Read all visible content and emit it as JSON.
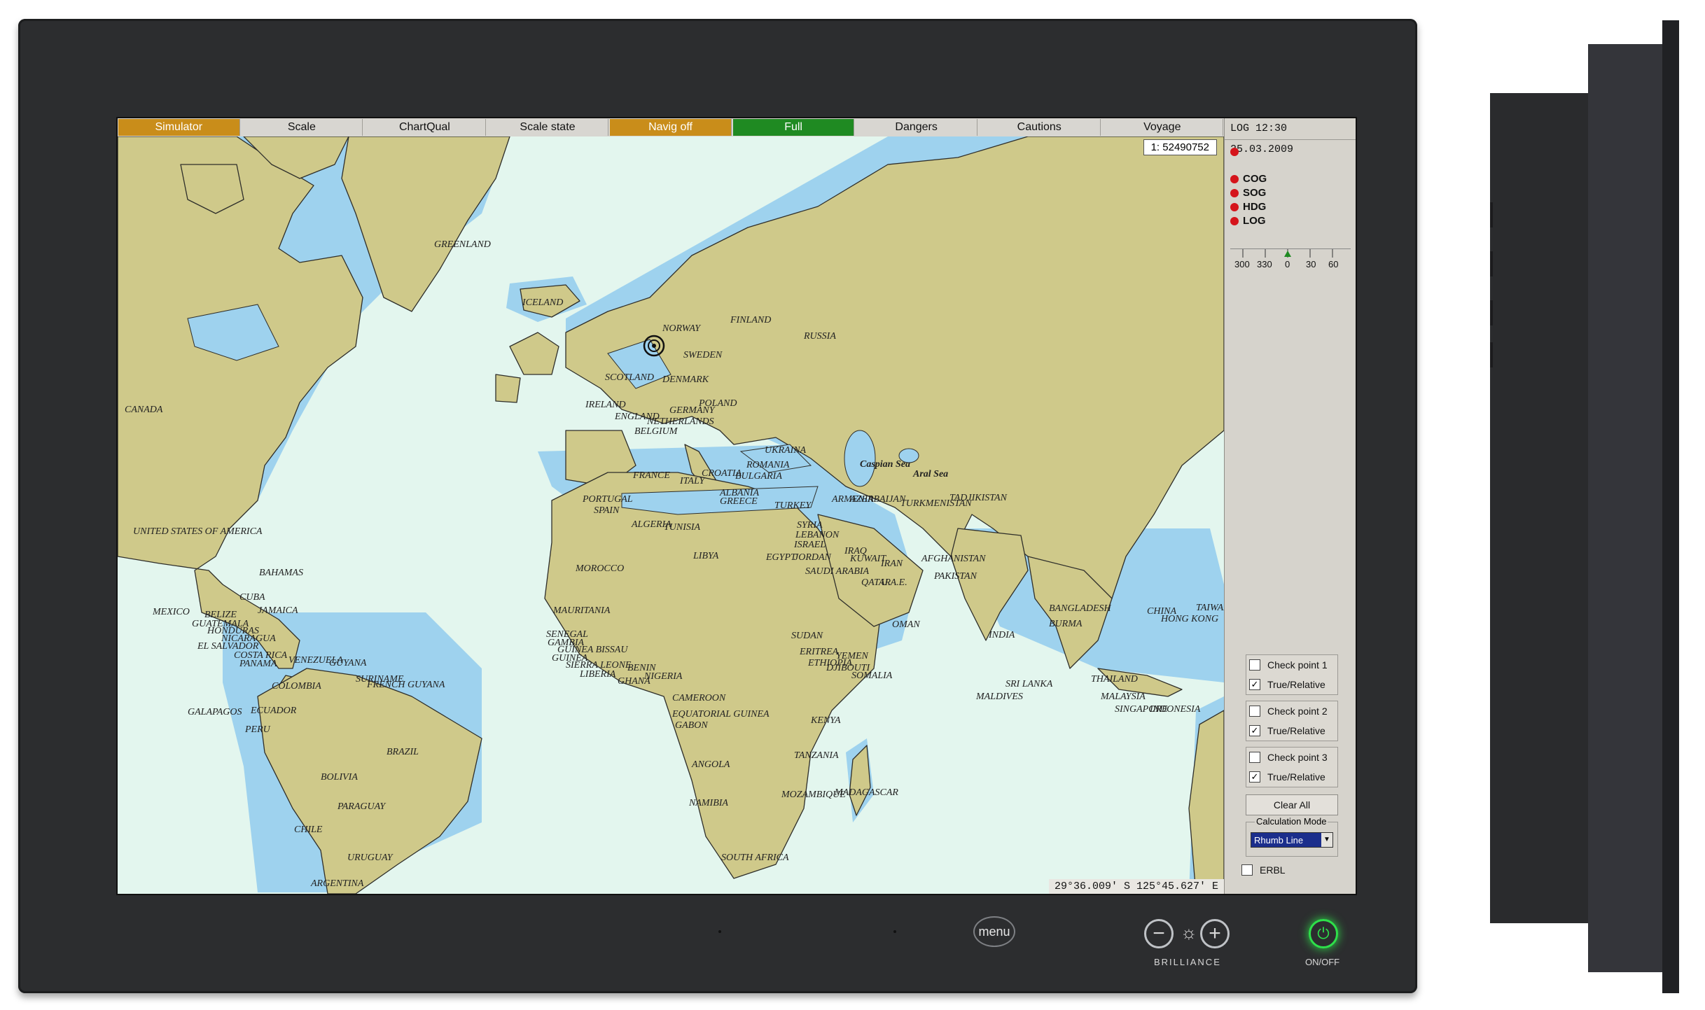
{
  "toolbar": {
    "items": [
      {
        "label": "Simulator",
        "state": "orange"
      },
      {
        "label": "Scale",
        "state": "normal"
      },
      {
        "label": "ChartQual",
        "state": "normal"
      },
      {
        "label": "Scale state",
        "state": "normal"
      },
      {
        "label": "Navig off",
        "state": "orange"
      },
      {
        "label": "Full",
        "state": "green"
      },
      {
        "label": "Dangers",
        "state": "normal"
      },
      {
        "label": "Cautions",
        "state": "normal"
      },
      {
        "label": "Voyage",
        "state": "normal"
      }
    ]
  },
  "map": {
    "scale": "1: 52490752",
    "cursor_position": "29°36.009' S  125°45.627' E",
    "labels": [
      {
        "text": "GREENLAND"
      },
      {
        "text": "ICELAND"
      },
      {
        "text": "CANADA"
      },
      {
        "text": "UNITED STATES OF AMERICA"
      },
      {
        "text": "NORWAY"
      },
      {
        "text": "FINLAND"
      },
      {
        "text": "SWEDEN"
      },
      {
        "text": "RUSSIA"
      },
      {
        "text": "SCOTLAND"
      },
      {
        "text": "DENMARK"
      },
      {
        "text": "IRELAND"
      },
      {
        "text": "ENGLAND"
      },
      {
        "text": "GERMANY"
      },
      {
        "text": "POLAND"
      },
      {
        "text": "NETHERLANDS"
      },
      {
        "text": "BELGIUM"
      },
      {
        "text": "UKRAINA"
      },
      {
        "text": "FRANCE"
      },
      {
        "text": "CROATIA"
      },
      {
        "text": "ROMANIA"
      },
      {
        "text": "BULGARIA"
      },
      {
        "text": "ITALY"
      },
      {
        "text": "ALBANIA"
      },
      {
        "text": "GREECE"
      },
      {
        "text": "TURKEY"
      },
      {
        "text": "PORTUGAL"
      },
      {
        "text": "SPAIN"
      },
      {
        "text": "Caspian Sea"
      },
      {
        "text": "Aral Sea"
      },
      {
        "text": "ARMENIA"
      },
      {
        "text": "AZERBAIJAN"
      },
      {
        "text": "TURKMENISTAN"
      },
      {
        "text": "TADJIKISTAN"
      },
      {
        "text": "ALGERIA"
      },
      {
        "text": "TUNISIA"
      },
      {
        "text": "SYRIA"
      },
      {
        "text": "LEBANON"
      },
      {
        "text": "ISRAEL"
      },
      {
        "text": "IRAQ"
      },
      {
        "text": "KUWAIT"
      },
      {
        "text": "IRAN"
      },
      {
        "text": "JORDAN"
      },
      {
        "text": "EGYPT"
      },
      {
        "text": "LIBYA"
      },
      {
        "text": "SAUDI ARABIA"
      },
      {
        "text": "QATAR"
      },
      {
        "text": "U.A.E."
      },
      {
        "text": "AFGHANISTAN"
      },
      {
        "text": "PAKISTAN"
      },
      {
        "text": "MOROCCO"
      },
      {
        "text": "BAHAMAS"
      },
      {
        "text": "CUBA"
      },
      {
        "text": "MEXICO"
      },
      {
        "text": "BELIZE"
      },
      {
        "text": "JAMAICA"
      },
      {
        "text": "GUATEMALA"
      },
      {
        "text": "HONDURAS"
      },
      {
        "text": "NICARAGUA"
      },
      {
        "text": "EL SALVADOR"
      },
      {
        "text": "COSTA RICA"
      },
      {
        "text": "PANAMA"
      },
      {
        "text": "VENEZUELA"
      },
      {
        "text": "GUYANA"
      },
      {
        "text": "SURINAME"
      },
      {
        "text": "FRENCH GUYANA"
      },
      {
        "text": "COLOMBIA"
      },
      {
        "text": "GALAPAGOS"
      },
      {
        "text": "ECUADOR"
      },
      {
        "text": "PERU"
      },
      {
        "text": "BRAZIL"
      },
      {
        "text": "BOLIVIA"
      },
      {
        "text": "PARAGUAY"
      },
      {
        "text": "CHILE"
      },
      {
        "text": "URUGUAY"
      },
      {
        "text": "ARGENTINA"
      },
      {
        "text": "MAURITANIA"
      },
      {
        "text": "SENEGAL"
      },
      {
        "text": "GAMBIA"
      },
      {
        "text": "GUINEA BISSAU"
      },
      {
        "text": "GUINEA"
      },
      {
        "text": "SIERRA LEONE"
      },
      {
        "text": "LIBERIA"
      },
      {
        "text": "BENIN"
      },
      {
        "text": "NIGERIA"
      },
      {
        "text": "GHANA"
      },
      {
        "text": "CAMEROON"
      },
      {
        "text": "EQUATORIAL GUINEA"
      },
      {
        "text": "GABON"
      },
      {
        "text": "SUDAN"
      },
      {
        "text": "ERITREA"
      },
      {
        "text": "YEMEN"
      },
      {
        "text": "ETHIOPIA"
      },
      {
        "text": "DJIBOUTI"
      },
      {
        "text": "SOMALIA"
      },
      {
        "text": "OMAN"
      },
      {
        "text": "KENYA"
      },
      {
        "text": "TANZANIA"
      },
      {
        "text": "ANGOLA"
      },
      {
        "text": "NAMIBIA"
      },
      {
        "text": "MOZAMBIQUE"
      },
      {
        "text": "MADAGASCAR"
      },
      {
        "text": "SOUTH AFRICA"
      },
      {
        "text": "INDIA"
      },
      {
        "text": "SRI LANKA"
      },
      {
        "text": "MALDIVES"
      },
      {
        "text": "BANGLADESH"
      },
      {
        "text": "BURMA"
      },
      {
        "text": "THAILAND"
      },
      {
        "text": "MALAYSIA"
      },
      {
        "text": "SINGAPORE"
      },
      {
        "text": "INDONESIA"
      },
      {
        "text": "CHINA"
      },
      {
        "text": "HONG KONG"
      },
      {
        "text": "TAIWAN"
      }
    ]
  },
  "sidebar": {
    "log_line": "LOG 12:30  25.03.2009",
    "status": [
      "COG",
      "SOG",
      "HDG",
      "LOG"
    ],
    "compass_ticks": [
      "300",
      "330",
      "0",
      "30",
      "60"
    ],
    "checkpoints": [
      {
        "label": "Check point 1",
        "checked": false,
        "mode_label": "True/Relative",
        "mode_checked": true
      },
      {
        "label": "Check point 2",
        "checked": false,
        "mode_label": "True/Relative",
        "mode_checked": true
      },
      {
        "label": "Check point 3",
        "checked": false,
        "mode_label": "True/Relative",
        "mode_checked": true
      }
    ],
    "clear_all": "Clear All",
    "calc_mode_title": "Calculation Mode",
    "calc_mode_value": "Rhumb Line",
    "erbl": "ERBL"
  },
  "hardware": {
    "menu_label": "menu",
    "brilliance_label": "BRILLIANCE",
    "power_label": "ON/OFF"
  },
  "colors": {
    "sea": "#e3f6ee",
    "shallow": "#9ed2ee",
    "land": "#cfc98a",
    "orange": "#c98d1a",
    "green": "#1f8a22",
    "bezel": "#2c2d2f"
  }
}
